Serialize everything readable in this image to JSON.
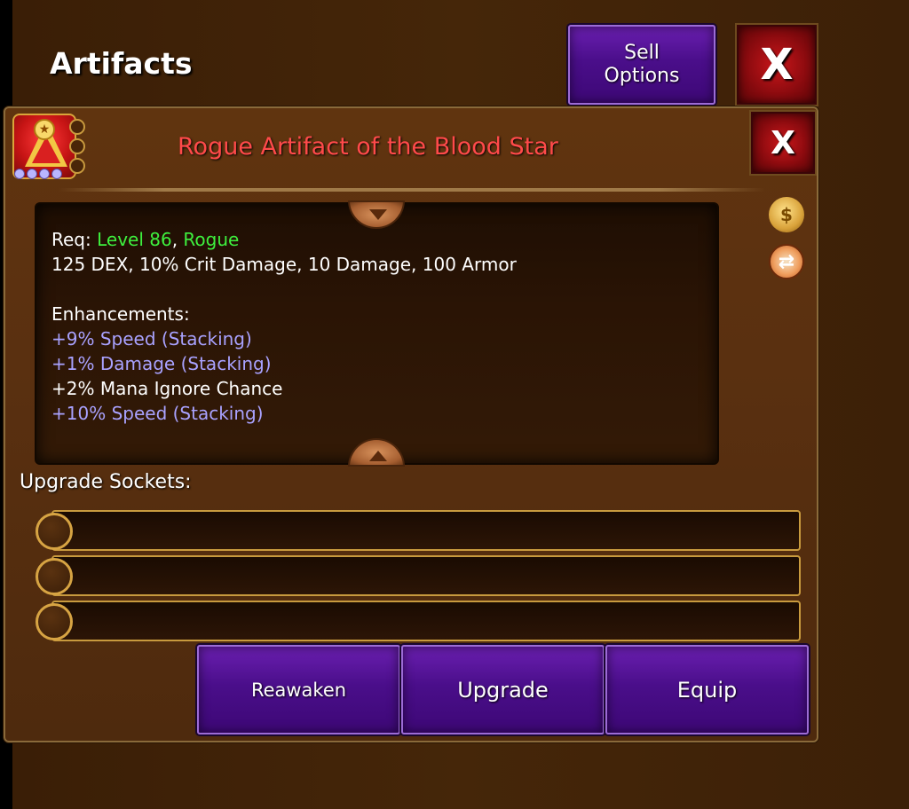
{
  "header": {
    "title": "Artifacts",
    "sell_line1": "Sell",
    "sell_line2": "Options",
    "close_label": "X"
  },
  "item": {
    "title": "Rogue Artifact of the Blood Star",
    "close_label": "X",
    "icon": "triangle-artifact-icon",
    "title_color": "#ff4a4a"
  },
  "description": {
    "req_prefix": "Req: ",
    "req_level": "Level 86",
    "req_sep": ", ",
    "req_class": "Rogue",
    "stats": "125 DEX, 10% Crit Damage, 10 Damage, 100 Armor",
    "enhancements_header": "Enhancements:",
    "enhancements": [
      {
        "text": "+9% Speed (Stacking)",
        "color": "#a9a2ff"
      },
      {
        "text": "+1% Damage (Stacking)",
        "color": "#a9a2ff"
      },
      {
        "text": "+2% Mana Ignore Chance",
        "color": "#ffffff"
      },
      {
        "text": "+10% Speed (Stacking)",
        "color": "#a9a2ff"
      }
    ]
  },
  "sockets": {
    "label": "Upgrade Sockets:",
    "count": 3
  },
  "actions": {
    "reawaken": "Reawaken",
    "upgrade": "Upgrade",
    "equip": "Equip"
  },
  "colors": {
    "accent_purple": "#4a0e8a",
    "close_red": "#c9161a",
    "requirement_green": "#3ef03e",
    "stacking_lavender": "#a9a2ff",
    "gold_border": "#c89a3e"
  }
}
